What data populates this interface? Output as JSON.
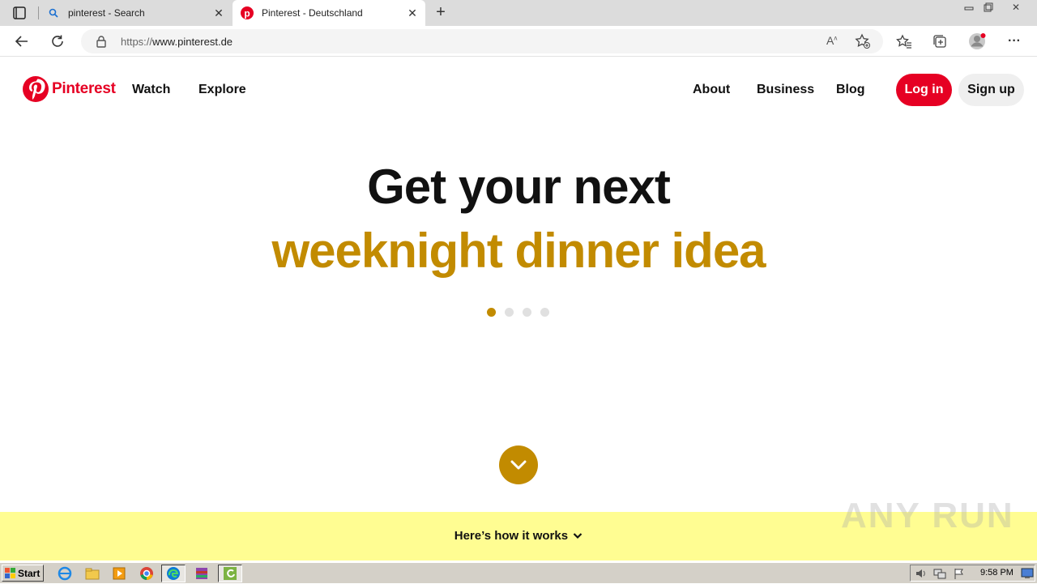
{
  "browser": {
    "tabs": [
      {
        "title": "pinterest - Search",
        "favicon": "search-icon",
        "active": false
      },
      {
        "title": "Pinterest - Deutschland",
        "favicon": "pinterest-icon",
        "active": true
      }
    ],
    "url_scheme": "https://",
    "url_host": "www.pinterest.de"
  },
  "header": {
    "logo_text": "Pinterest",
    "nav_left": [
      "Watch",
      "Explore"
    ],
    "nav_right": [
      "About",
      "Business",
      "Blog"
    ],
    "login_label": "Log in",
    "signup_label": "Sign up"
  },
  "hero": {
    "line1": "Get your next",
    "line2": "weeknight dinner idea",
    "line2_color": "#c28b00",
    "carousel_total": 4,
    "carousel_active_index": 0
  },
  "band": {
    "text": "Here’s how it works"
  },
  "watermark": "ANY RUN",
  "taskbar": {
    "start_label": "Start",
    "clock": "9:58 PM"
  },
  "colors": {
    "brand_red": "#e60023",
    "accent_gold": "#c28b00",
    "band_yellow": "#fffd92"
  }
}
